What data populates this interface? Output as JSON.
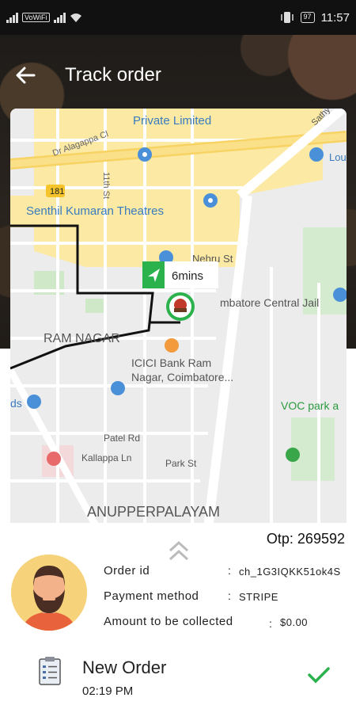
{
  "status_bar": {
    "network_label": "VoWiFi",
    "battery": "97",
    "time": "11:57"
  },
  "header": {
    "title": "Track order",
    "back_icon": "arrow-left-icon"
  },
  "map": {
    "labels": {
      "private_limited": "Private Limited",
      "dr_alagappa": "Dr Alagappa Cl",
      "theatre": "Senthil Kumaran Theatres",
      "road_181": "181",
      "nehru": "Nehru St",
      "jail": "mbatore Central Jail",
      "ram_nagar": "RAM NAGAR",
      "icici": "ICICI Bank Ram\nNagar, Coimbatore...",
      "voc": "VOC park a",
      "patel": "Patel Rd",
      "kallappa": "Kallappa Ln",
      "park": "Park St",
      "anupper": "ANUPPERPALAYAM",
      "lou": "Lou",
      "ds": "ds",
      "eleventh": "11th St",
      "sathy": "Sathy"
    },
    "eta": "6mins"
  },
  "order": {
    "otp_label": "Otp: 269592",
    "order_id_label": "Order id",
    "order_id_value": "ch_1G3IQKK51ok4S",
    "payment_label": "Payment method",
    "payment_value": "STRIPE",
    "amount_label": "Amount to be collected",
    "amount_value": "$0.00",
    "separator": ":"
  },
  "status": {
    "title": "New Order",
    "time": "02:19 PM",
    "icon": "checklist-icon",
    "done_icon": "check-icon"
  },
  "colors": {
    "accent_green": "#2bb24c",
    "map_yellow": "#fbe9a4",
    "route": "#111111"
  }
}
